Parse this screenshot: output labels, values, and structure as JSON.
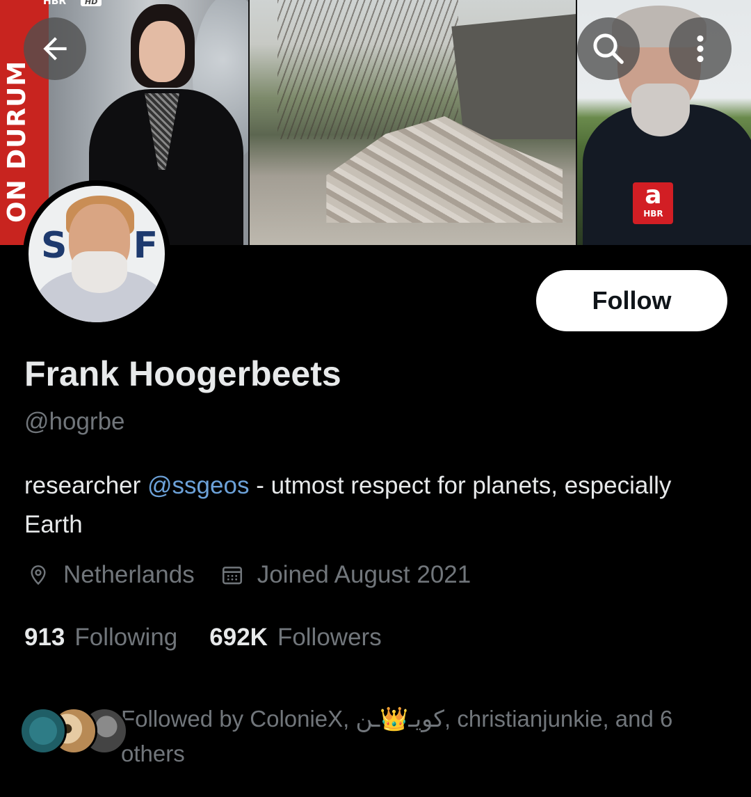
{
  "banner": {
    "channel_tag": "HBR",
    "hd_tag": "HD",
    "strip_text": "ON DURUM",
    "logo_letter": "a",
    "logo_text": "HBR"
  },
  "top_bar": {
    "back_icon": "arrow-left-icon",
    "search_icon": "search-icon",
    "more_icon": "more-vertical-icon"
  },
  "avatar": {
    "logo_text": "SSF"
  },
  "profile": {
    "follow_label": "Follow",
    "display_name": "Frank Hoogerbeets",
    "handle": "@hogrbe",
    "bio_before": "researcher ",
    "bio_mention": "@ssgeos",
    "bio_after": " - utmost respect for planets, especially Earth",
    "location": "Netherlands",
    "location_icon": "location-pin-icon",
    "joined": "Joined August 2021",
    "joined_icon": "calendar-icon",
    "following_count": "913",
    "following_label": "Following",
    "followers_count": "692K",
    "followers_label": "Followers",
    "followed_by_text": "Followed by ColonieX, كويـ👑ـن, christianjunkie, and 6 others"
  },
  "colors": {
    "background": "#000000",
    "primary_text": "#e7e9ea",
    "secondary_text": "#71767b",
    "link": "#6ca1d8",
    "follow_button_bg": "#ffffff",
    "banner_accent": "#c8241f"
  }
}
